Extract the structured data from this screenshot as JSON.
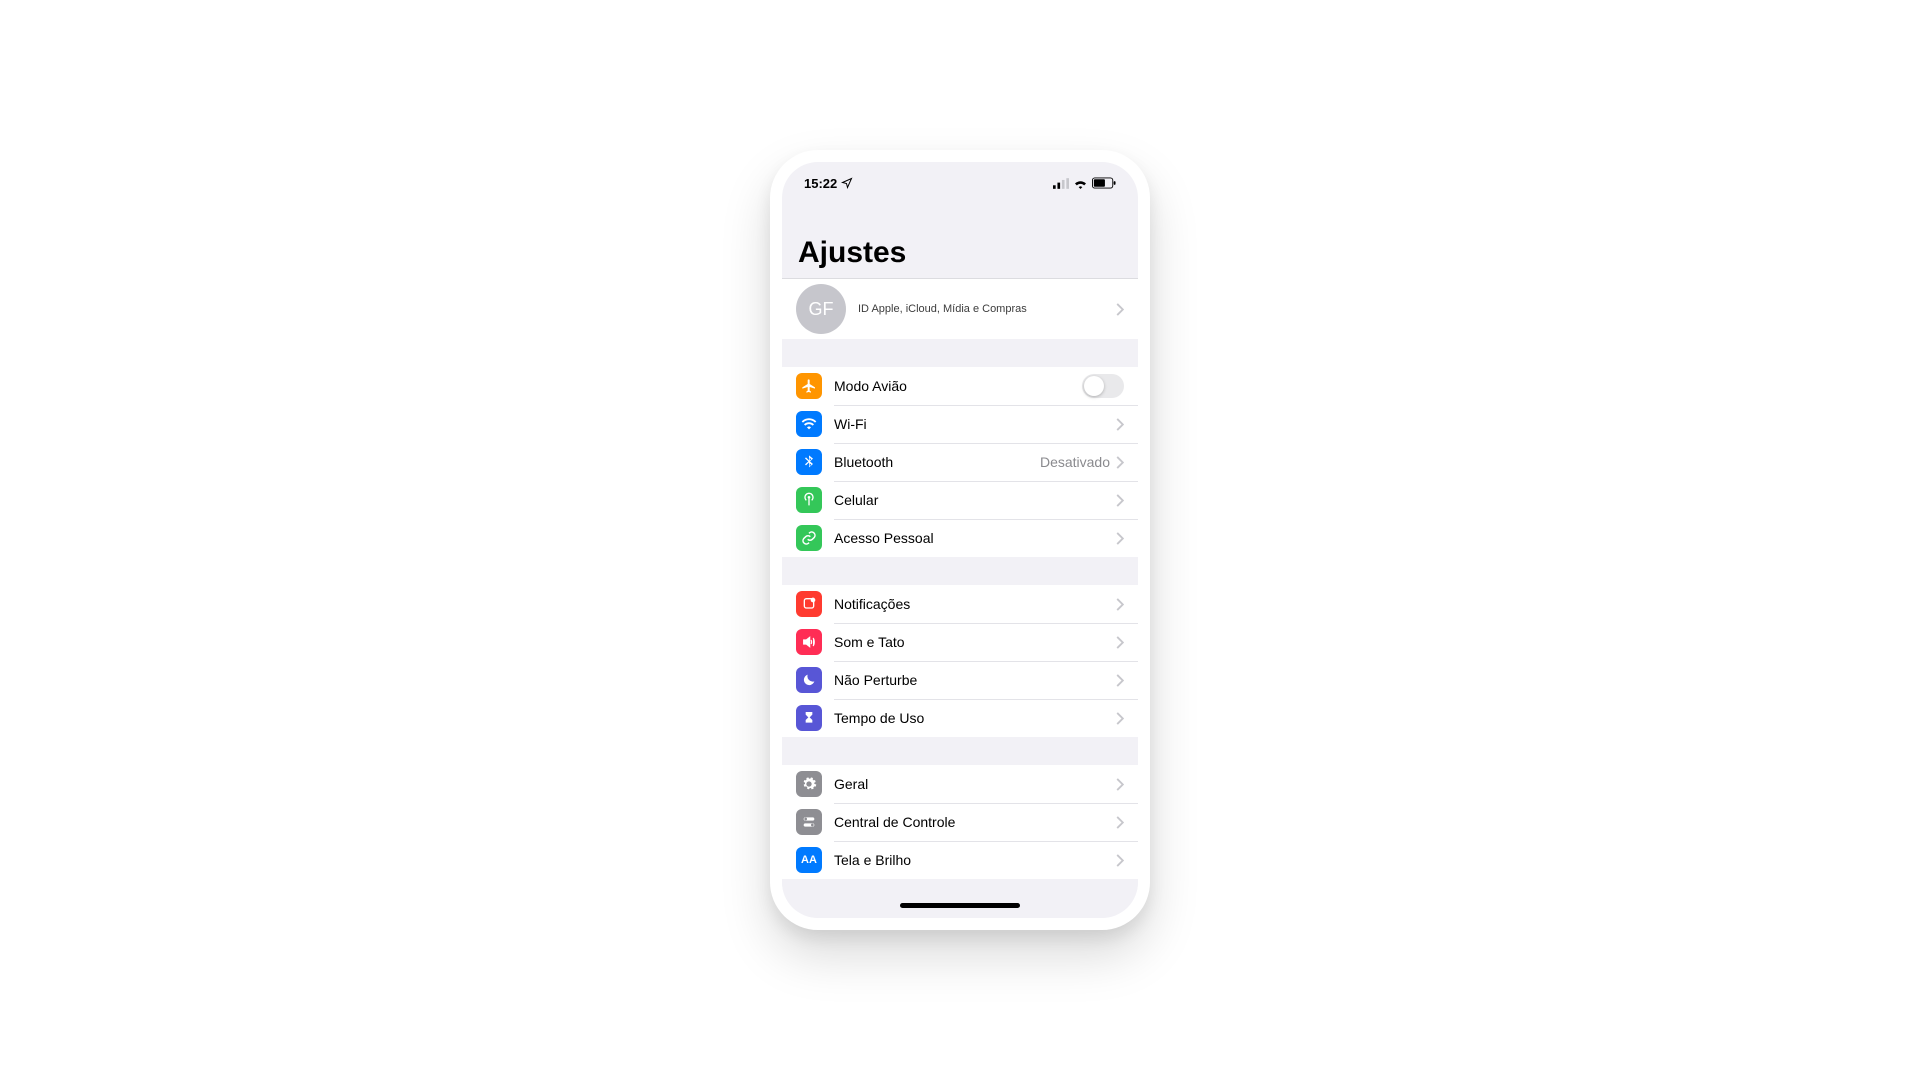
{
  "status": {
    "time": "15:22"
  },
  "header": {
    "title": "Ajustes"
  },
  "profile": {
    "initials": "GF",
    "subtitle": "ID Apple, iCloud, Mídia e Compras"
  },
  "groups": [
    {
      "rows": [
        {
          "id": "airplane",
          "label": "Modo Avião",
          "icon": "airplane",
          "color": "c-orange",
          "control": "toggle",
          "toggle": false
        },
        {
          "id": "wifi",
          "label": "Wi-Fi",
          "icon": "wifi",
          "color": "c-blue",
          "control": "chevron"
        },
        {
          "id": "bluetooth",
          "label": "Bluetooth",
          "icon": "bluetooth",
          "color": "c-blue",
          "control": "chevron",
          "value": "Desativado"
        },
        {
          "id": "cellular",
          "label": "Celular",
          "icon": "antenna",
          "color": "c-green",
          "control": "chevron"
        },
        {
          "id": "hotspot",
          "label": "Acesso Pessoal",
          "icon": "link",
          "color": "c-green2",
          "control": "chevron"
        }
      ]
    },
    {
      "rows": [
        {
          "id": "notifications",
          "label": "Notificações",
          "icon": "bell",
          "color": "c-red",
          "control": "chevron"
        },
        {
          "id": "sounds",
          "label": "Som e Tato",
          "icon": "speaker",
          "color": "c-pink",
          "control": "chevron"
        },
        {
          "id": "dnd",
          "label": "Não Perturbe",
          "icon": "moon",
          "color": "c-purple",
          "control": "chevron"
        },
        {
          "id": "screentime",
          "label": "Tempo de Uso",
          "icon": "hourglass",
          "color": "c-purple2",
          "control": "chevron"
        }
      ]
    },
    {
      "rows": [
        {
          "id": "general",
          "label": "Geral",
          "icon": "gear",
          "color": "c-gray",
          "control": "chevron"
        },
        {
          "id": "controlcenter",
          "label": "Central de Controle",
          "icon": "switches",
          "color": "c-gray2",
          "control": "chevron"
        },
        {
          "id": "display",
          "label": "Tela e Brilho",
          "icon": "aa",
          "color": "c-blue2",
          "control": "chevron"
        }
      ]
    }
  ]
}
